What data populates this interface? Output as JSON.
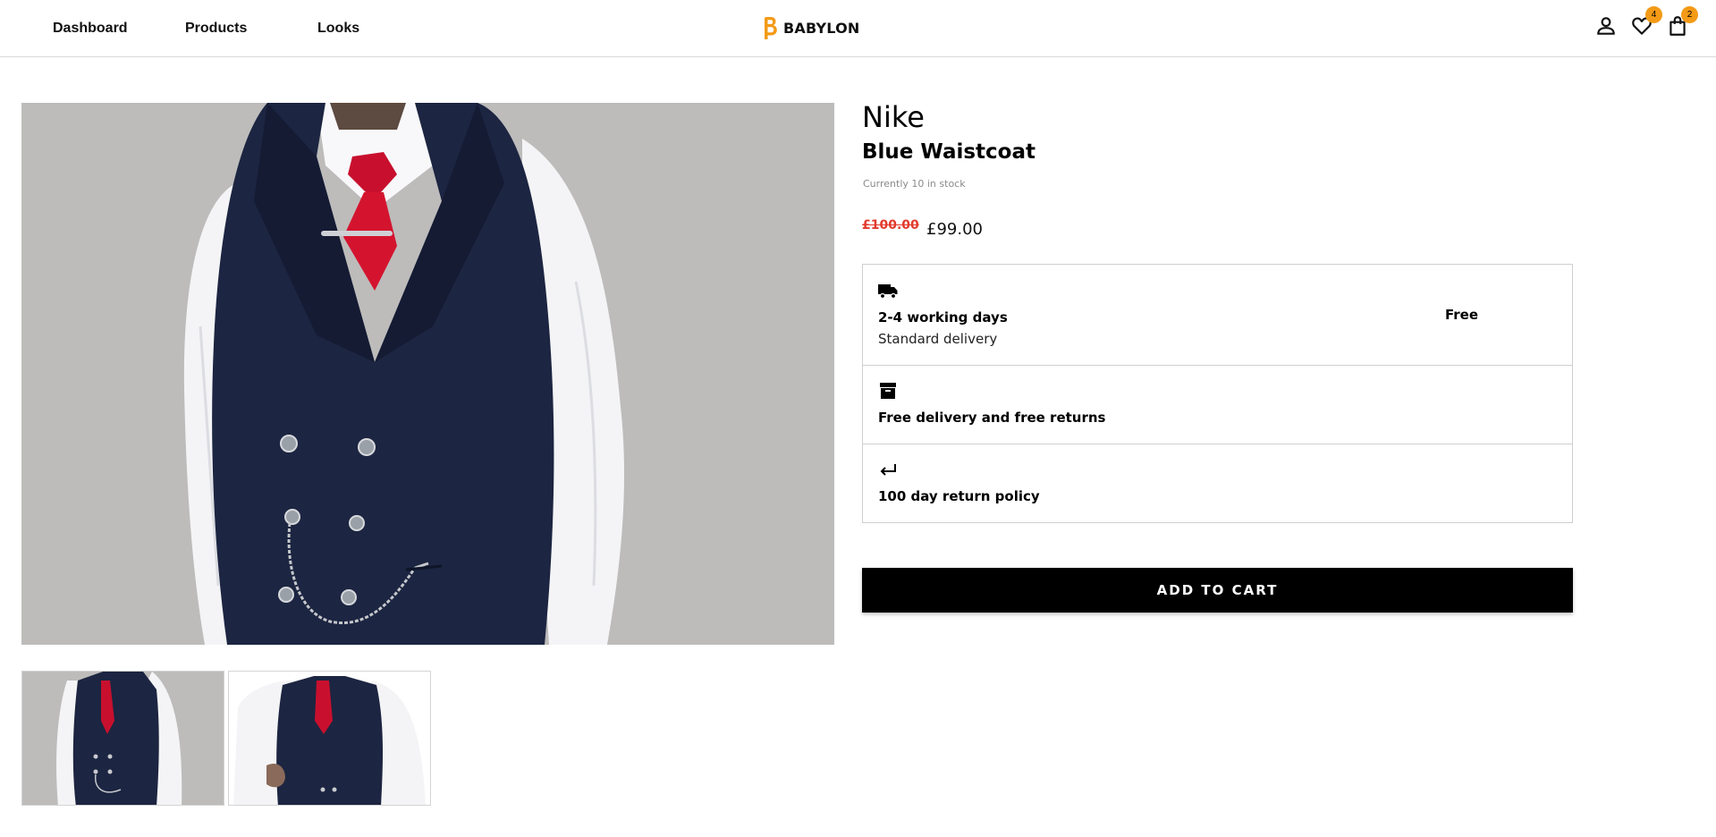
{
  "nav": {
    "items": [
      {
        "label": "Dashboard"
      },
      {
        "label": "Products"
      },
      {
        "label": "Looks"
      }
    ]
  },
  "brand": {
    "name": "BABYLON",
    "accent": "#f39a16"
  },
  "header_icons": {
    "account": {
      "icon": "user-icon"
    },
    "wishlist": {
      "icon": "heart-icon",
      "count": "4"
    },
    "cart": {
      "icon": "shopping-bag-icon",
      "count": "2"
    }
  },
  "product": {
    "brand": "Nike",
    "name": "Blue Waistcoat",
    "stock": "Currently 10 in stock",
    "old_price": "£100.00",
    "price": "£99.00",
    "sale_color": "#e23a2c"
  },
  "info": {
    "delivery": {
      "icon": "truck-icon",
      "title": "2-4 working days",
      "subtitle": "Standard delivery",
      "cost": "Free"
    },
    "returns": {
      "icon": "archive-box-icon",
      "title": "Free delivery and free returns"
    },
    "policy": {
      "icon": "return-arrow-icon",
      "title": "100 day return policy"
    }
  },
  "actions": {
    "add_to_cart": "ADD TO CART"
  }
}
